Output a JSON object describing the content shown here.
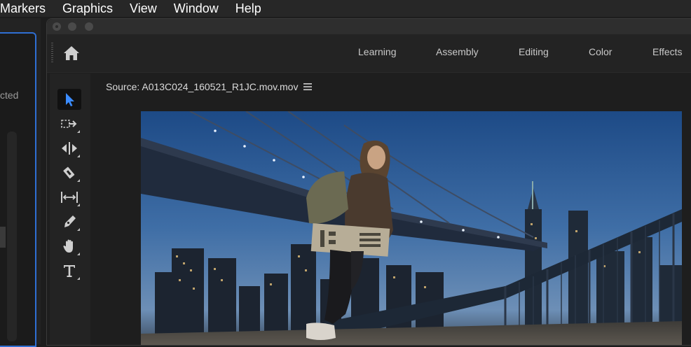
{
  "menubar": {
    "items": [
      "Markers",
      "Graphics",
      "View",
      "Window",
      "Help"
    ]
  },
  "left_panel": {
    "cut_text": "cted"
  },
  "workspaces": {
    "tabs": [
      "Learning",
      "Assembly",
      "Editing",
      "Color",
      "Effects"
    ]
  },
  "toolbar": {
    "tools": [
      {
        "icon": "selection-tool-icon",
        "selected": true
      },
      {
        "icon": "track-select-forward-icon",
        "selected": false
      },
      {
        "icon": "ripple-edit-icon",
        "selected": false
      },
      {
        "icon": "razor-tool-icon",
        "selected": false
      },
      {
        "icon": "slip-tool-icon",
        "selected": false
      },
      {
        "icon": "pen-tool-icon",
        "selected": false
      },
      {
        "icon": "hand-tool-icon",
        "selected": false
      },
      {
        "icon": "type-tool-icon",
        "selected": false
      }
    ]
  },
  "source_monitor": {
    "title": "Source: A013C024_160521_R1JC.mov.mov",
    "menu_icon": "hamburger-menu-icon"
  },
  "colors": {
    "accent": "#2f6fd3",
    "selected_tool": "#3b8cff"
  }
}
